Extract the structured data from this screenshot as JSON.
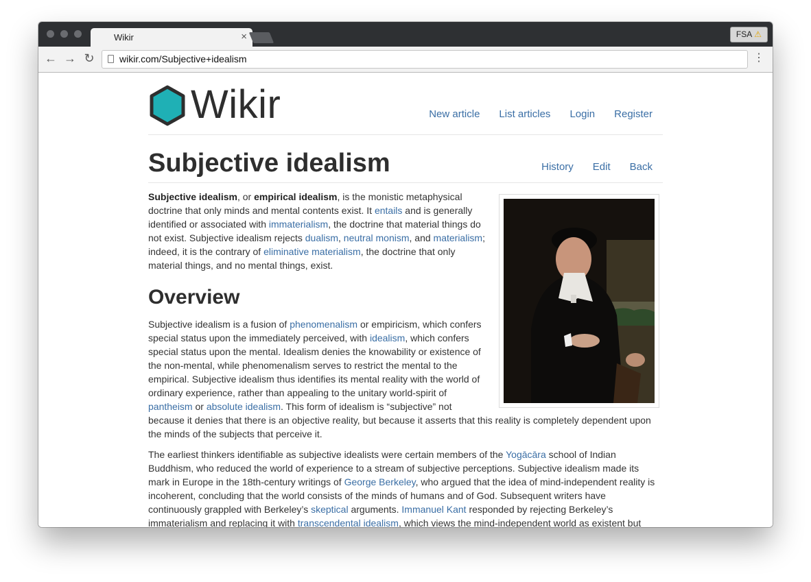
{
  "browser": {
    "tab_title": "Wikir",
    "tab_close": "×",
    "fsa_label": "FSA",
    "fsa_warning": "⚠",
    "url": "wikir.com/Subjective+idealism",
    "back_icon": "←",
    "forward_icon": "→",
    "reload_icon": "↻",
    "menu_icon": "⋮"
  },
  "site": {
    "logo_text": "Wikir",
    "logo_color": "#1fb0b5",
    "nav": [
      "New article",
      "List articles",
      "Login",
      "Register"
    ]
  },
  "article": {
    "title": "Subjective idealism",
    "actions": [
      "History",
      "Edit",
      "Back"
    ],
    "intro": {
      "t0": "Subjective idealism",
      "t1": ", or ",
      "t2": "empirical idealism",
      "t3": ", is the monistic metaphysical doctrine that only minds and mental contents exist. It ",
      "l1": "entails",
      "t4": " and is generally identified or associated with ",
      "l2": "immaterialism",
      "t5": ", the doctrine that material things do not exist. Subjective idealism rejects ",
      "l3": "dualism",
      "t6": ", ",
      "l4": "neutral monism",
      "t7": ", and ",
      "l5": "materialism",
      "t8": "; indeed, it is the contrary of ",
      "l6": "eliminative materialism",
      "t9": ", the doctrine that only material things, and no mental things, exist."
    },
    "overview_heading": "Overview",
    "p2": {
      "t0": "Subjective idealism is a fusion of ",
      "l1": "phenomenalism",
      "t1": " or empiricism, which confers special status upon the immediately perceived, with ",
      "l2": "idealism",
      "t2": ", which confers special status upon the mental. Idealism denies the knowability or existence of the non-mental, while phenomenalism serves to restrict the mental to the empirical. Subjective idealism thus identifies its mental reality with the world of ordinary experience, rather than appealing to the unitary world-spirit of ",
      "l3": "pantheism",
      "t3": " or ",
      "l4": "absolute idealism",
      "t4": ". This form of idealism is “subjective” not because it denies that there is an objective reality, but because it asserts that this reality is completely dependent upon the minds of the subjects that perceive it."
    },
    "p3": {
      "t0": "The earliest thinkers identifiable as subjective idealists were certain members of the ",
      "l1": "Yogācāra",
      "t1": " school of Indian Buddhism, who reduced the world of experience to a stream of subjective perceptions. Subjective idealism made its mark in Europe in the 18th-century writings of ",
      "l2": "George Berkeley",
      "t2": ", who argued that the idea of mind-independent reality is incoherent, concluding that the world consists of the minds of humans and of God. Subsequent writers have continuously grappled with Berkeley’s ",
      "l3": "skeptical",
      "t3": " arguments. ",
      "l4": "Immanuel Kant",
      "t4": " responded by rejecting Berkeley’s immaterialism and replacing it with ",
      "l5": "transcendental idealism",
      "t5": ", which views the mind-independent world as existent but"
    }
  },
  "colors": {
    "link": "#3a6ea5",
    "text": "#333333",
    "chrome_dark": "#2e3033",
    "toolbar": "#f2f2f2"
  }
}
